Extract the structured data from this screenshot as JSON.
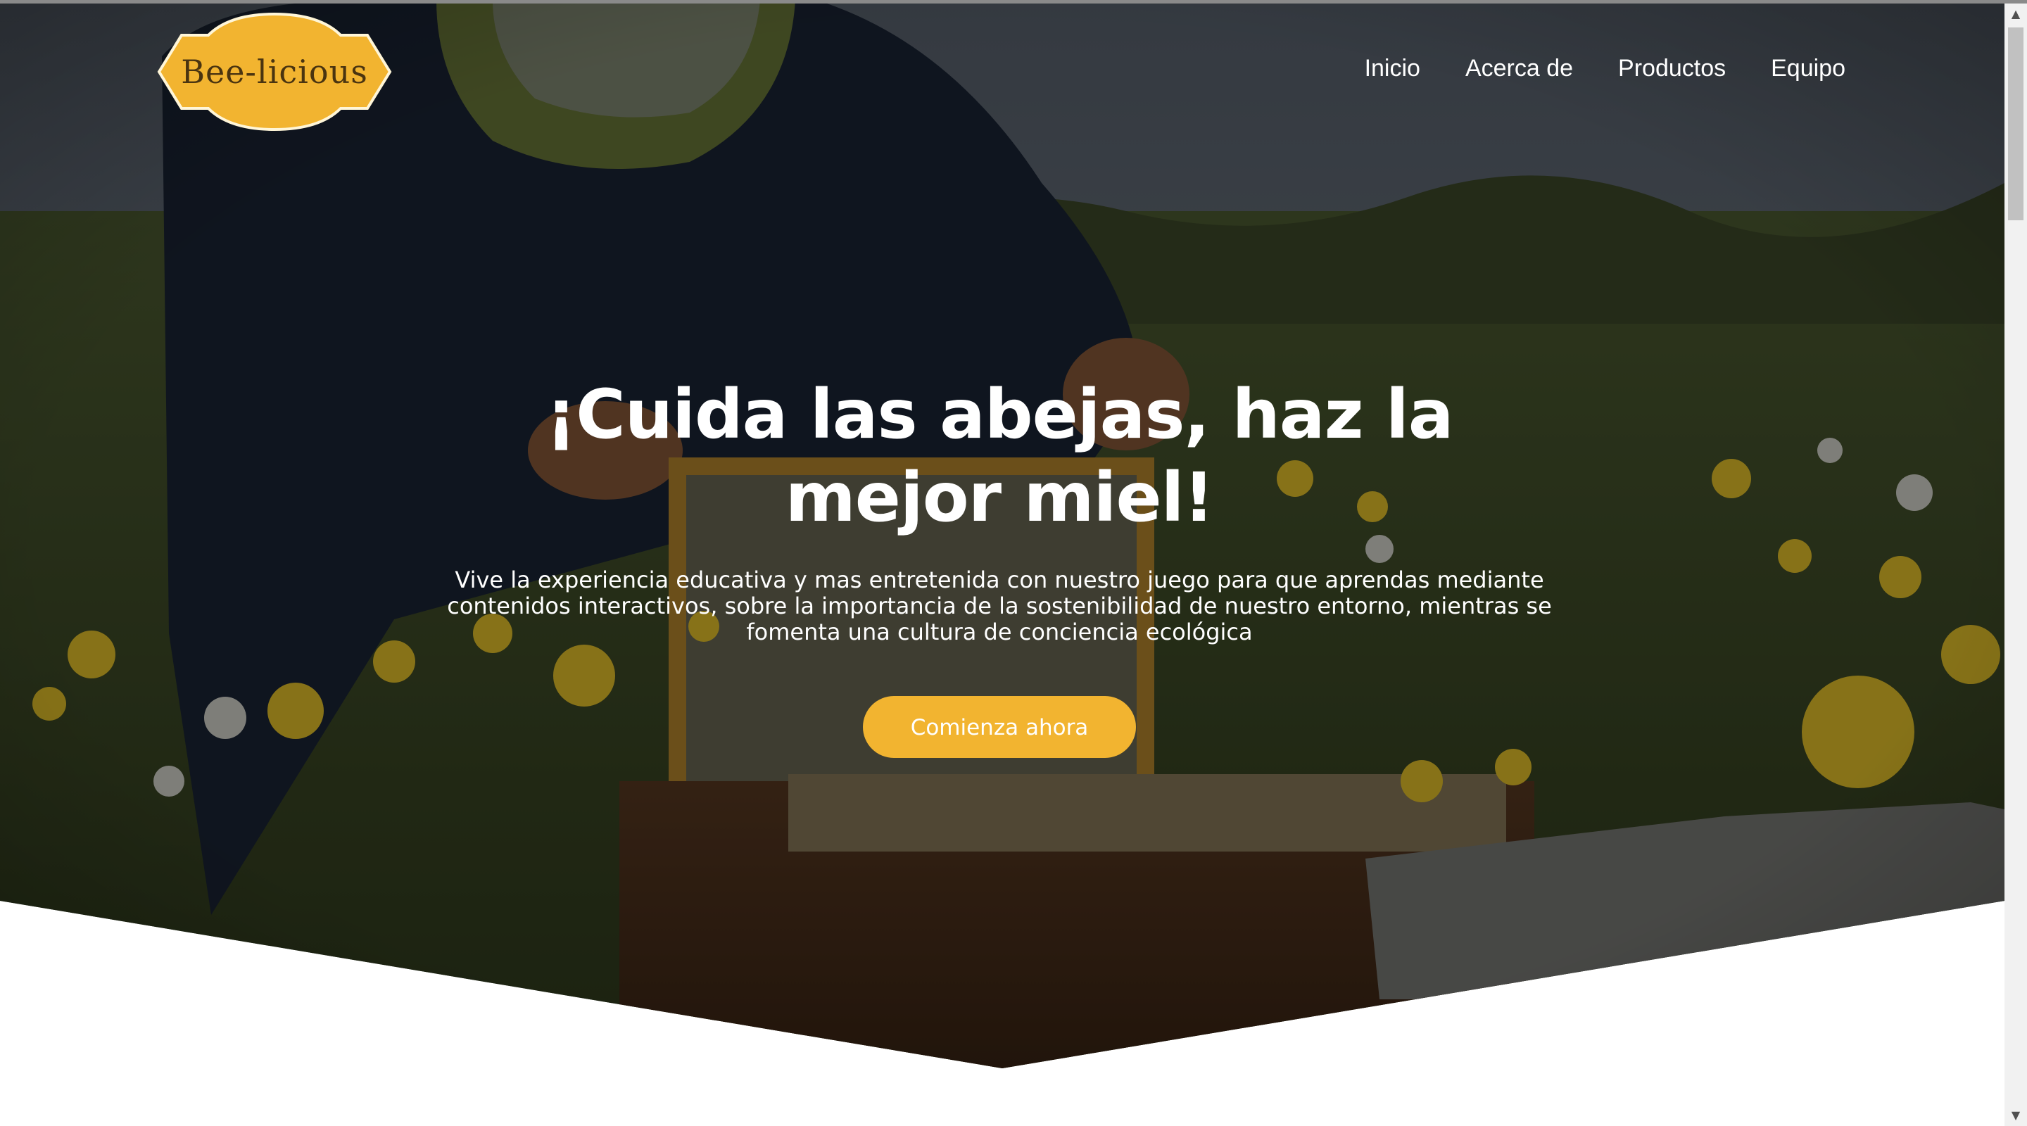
{
  "brand": {
    "logo_text": "Bee-licious",
    "logo_color": "#f2b430"
  },
  "nav": {
    "items": [
      {
        "label": "Inicio"
      },
      {
        "label": "Acerca de"
      },
      {
        "label": "Productos"
      },
      {
        "label": "Equipo"
      }
    ]
  },
  "hero": {
    "title": "¡Cuida las abejas, haz la mejor miel!",
    "description": "Vive la experiencia educativa y mas entretenida con nuestro juego para que aprendas mediante contenidos interactivos, sobre la importancia de la sostenibilidad de nuestro entorno, mientras se fomenta una cultura de conciencia ecológica",
    "cta_label": "Comienza ahora",
    "background": "photo of a beekeeper holding a honeycomb frame above a hive in a field of yellow wildflowers"
  },
  "colors": {
    "accent": "#f2b430",
    "text_light": "#ffffff"
  },
  "scrollbar": {
    "up_icon": "scroll-up-arrow",
    "down_icon": "scroll-down-arrow"
  }
}
